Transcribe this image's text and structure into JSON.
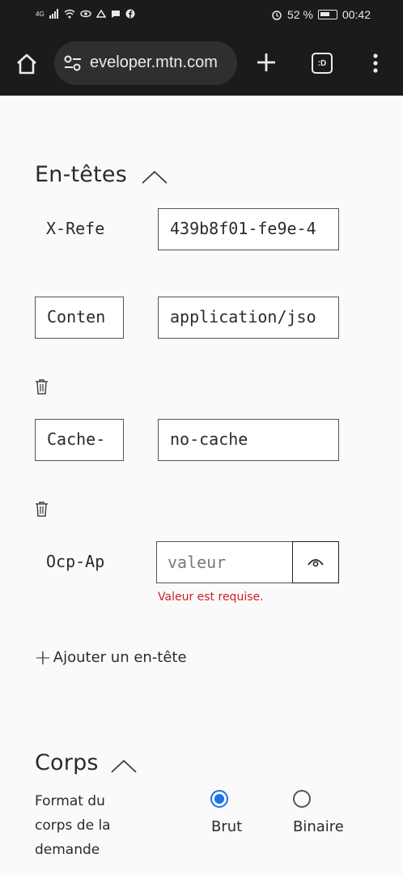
{
  "status_bar": {
    "left_text": "4G",
    "battery": "52 %",
    "time": "00:42"
  },
  "browser": {
    "url": "eveloper.mtn.com",
    "tabs_label": ":D",
    "icons": [
      "home-icon",
      "site-settings-icon",
      "new-tab-icon",
      "tab-switcher-icon",
      "more-menu-icon"
    ]
  },
  "headers_section": {
    "title": "En-têtes",
    "rows": [
      {
        "key": "X-Refe",
        "value": "439b8f01-fe9e-4"
      },
      {
        "key": "Conten",
        "value": "application/jso"
      },
      {
        "key": "Cache-",
        "value": "no-cache"
      },
      {
        "key": "Ocp-Ap",
        "value": "",
        "placeholder": "valeur"
      }
    ],
    "error": "Valeur est requise.",
    "add_label": "Ajouter un en-tête"
  },
  "body_section": {
    "title": "Corps",
    "format_label": "Format du corps de la demande",
    "options": [
      {
        "label": "Brut",
        "selected": true
      },
      {
        "label": "Binaire",
        "selected": false
      }
    ]
  },
  "colors": {
    "accent": "#1a73e8",
    "error": "#d0202a",
    "chrome": "#1b1b1b"
  }
}
